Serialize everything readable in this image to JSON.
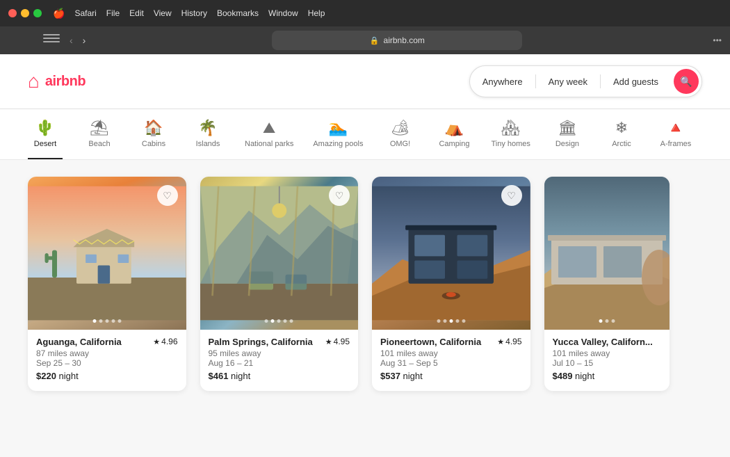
{
  "mac": {
    "menu": {
      "apple": "🍎",
      "items": [
        "Safari",
        "File",
        "Edit",
        "View",
        "History",
        "Bookmarks",
        "Window",
        "Help"
      ]
    },
    "browser": {
      "address": "airbnb.com"
    }
  },
  "header": {
    "logo_text": "airbnb",
    "search": {
      "anywhere": "Anywhere",
      "any_week": "Any week",
      "add_guests": "Add guests"
    }
  },
  "categories": [
    {
      "id": "desert",
      "label": "Desert",
      "icon": "🌵",
      "active": true
    },
    {
      "id": "beach",
      "label": "Beach",
      "icon": "🏖",
      "active": false
    },
    {
      "id": "cabins",
      "label": "Cabins",
      "icon": "🏠",
      "active": false
    },
    {
      "id": "islands",
      "label": "Islands",
      "icon": "🌴",
      "active": false
    },
    {
      "id": "national-parks",
      "label": "National parks",
      "icon": "⛰",
      "active": false
    },
    {
      "id": "amazing-pools",
      "label": "Amazing pools",
      "icon": "🏊",
      "active": false
    },
    {
      "id": "omg",
      "label": "OMG!",
      "icon": "🏕",
      "active": false
    },
    {
      "id": "camping",
      "label": "Camping",
      "icon": "⛺",
      "active": false
    },
    {
      "id": "tiny-homes",
      "label": "Tiny homes",
      "icon": "🏘",
      "active": false
    },
    {
      "id": "design",
      "label": "Design",
      "icon": "🏛",
      "active": false
    },
    {
      "id": "arctic",
      "label": "Arctic",
      "icon": "❄",
      "active": false
    },
    {
      "id": "a-frames",
      "label": "A-frames",
      "icon": "🔺",
      "active": false
    }
  ],
  "listings": [
    {
      "id": 1,
      "location": "Aguanga, California",
      "rating": "4.96",
      "distance": "87 miles away",
      "dates": "Sep 25 – 30",
      "price": "$220",
      "price_unit": "night",
      "dots": 5,
      "active_dot": 0
    },
    {
      "id": 2,
      "location": "Palm Springs, California",
      "rating": "4.95",
      "distance": "95 miles away",
      "dates": "Aug 16 – 21",
      "price": "$461",
      "price_unit": "night",
      "dots": 5,
      "active_dot": 1
    },
    {
      "id": 3,
      "location": "Pioneertown, California",
      "rating": "4.95",
      "distance": "101 miles away",
      "dates": "Aug 31 – Sep 5",
      "price": "$537",
      "price_unit": "night",
      "dots": 5,
      "active_dot": 2
    },
    {
      "id": 4,
      "location": "Yucca Valley, Californ...",
      "rating": "—",
      "distance": "101 miles away",
      "dates": "Jul 10 – 15",
      "price": "$489",
      "price_unit": "night",
      "dots": 3,
      "active_dot": 0
    }
  ],
  "heart_icon": "♡",
  "star_icon": "★"
}
